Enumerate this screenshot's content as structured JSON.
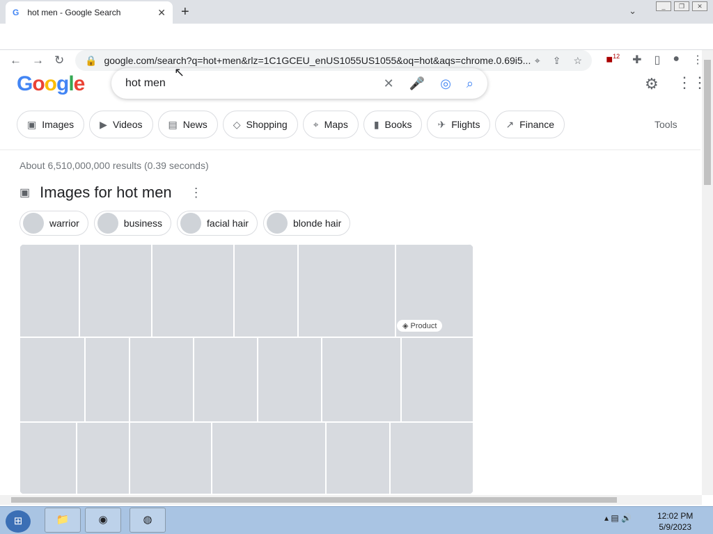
{
  "browser": {
    "tab_title": "hot men - Google Search",
    "url": "google.com/search?q=hot+men&rlz=1C1GCEU_enUS1055US1055&oq=hot&aqs=chrome.0.69i5...",
    "extension_badge": "12"
  },
  "search": {
    "logo": "Google",
    "query": "hot men",
    "tools_label": "Tools",
    "results_stats": "About 6,510,000,000 results (0.39 seconds)"
  },
  "filters": [
    "Images",
    "Videos",
    "News",
    "Shopping",
    "Maps",
    "Books",
    "Flights",
    "Finance"
  ],
  "images": {
    "heading": "Images for hot men",
    "related": [
      "warrior",
      "business",
      "facial hair",
      "blonde hair"
    ],
    "product_badge": "Product"
  },
  "taskbar": {
    "time": "12:02 PM",
    "date": "5/9/2023"
  }
}
